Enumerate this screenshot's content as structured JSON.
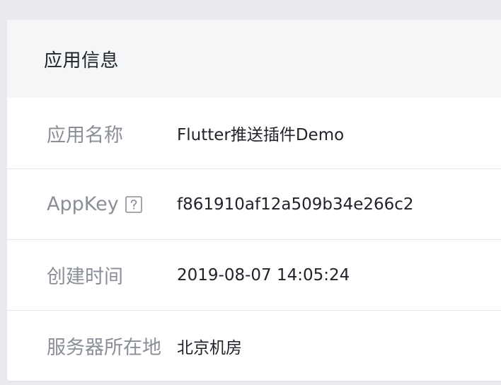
{
  "card": {
    "title": "应用信息"
  },
  "rows": [
    {
      "label": "应用名称",
      "value": "Flutter推送插件Demo"
    },
    {
      "label": "AppKey",
      "value": "f861910af12a509b34e266c2",
      "icon": "help-icon"
    },
    {
      "label": "创建时间",
      "value": "2019-08-07 14:05:24"
    },
    {
      "label": "服务器所在地",
      "value": "北京机房"
    }
  ],
  "colors": {
    "page_background": "#e9ebee",
    "header_background": "#f5f6f8",
    "label_text": "#8a8f97",
    "value_text": "#1f2329",
    "divider": "#e4e6ea"
  }
}
